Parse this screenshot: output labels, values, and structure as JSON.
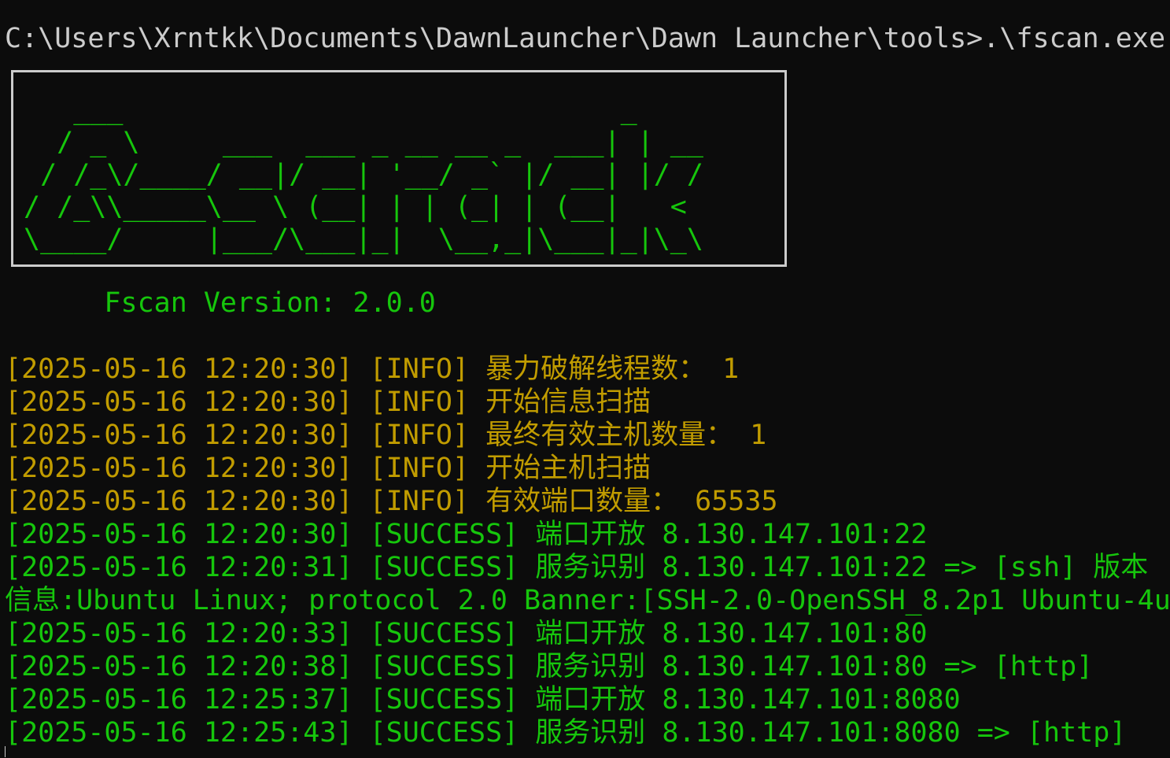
{
  "terminal": {
    "command_line": "C:\\Users\\Xrntkk\\Documents\\DawnLauncher\\Dawn Launcher\\tools>.\\fscan.exe",
    "banner_ascii": "   ___                              _\n  / _ \\     ___  ___ _ __ __ _  ___| | __\n / /_\\/____/ __|/ __| '__/ _` |/ __| |/ /\n/ /_\\\\_____\\__ \\ (__| | | (_| | (__|   <\n\\____/     |___/\\___|_|  \\__,_|\\___|_|\\_\\",
    "version_line": "      Fscan Version: 2.0.0",
    "colors": {
      "background": "#0c0c0c",
      "default_text": "#cccccc",
      "info": "#c19c00",
      "success": "#16c60c"
    },
    "log_lines": [
      {
        "level": "info",
        "text": "[2025-05-16 12:20:30] [INFO] 暴力破解线程数： 1"
      },
      {
        "level": "info",
        "text": "[2025-05-16 12:20:30] [INFO] 开始信息扫描"
      },
      {
        "level": "info",
        "text": "[2025-05-16 12:20:30] [INFO] 最终有效主机数量： 1"
      },
      {
        "level": "info",
        "text": "[2025-05-16 12:20:30] [INFO] 开始主机扫描"
      },
      {
        "level": "info",
        "text": "[2025-05-16 12:20:30] [INFO] 有效端口数量： 65535"
      },
      {
        "level": "success",
        "text": "[2025-05-16 12:20:30] [SUCCESS] 端口开放 8.130.147.101:22"
      },
      {
        "level": "success",
        "text": "[2025-05-16 12:20:31] [SUCCESS] 服务识别 8.130.147.101:22 => [ssh] 版本"
      },
      {
        "level": "success",
        "text": "信息:Ubuntu Linux; protocol 2.0 Banner:[SSH-2.0-OpenSSH_8.2p1 Ubuntu-4u"
      },
      {
        "level": "success",
        "text": "[2025-05-16 12:20:33] [SUCCESS] 端口开放 8.130.147.101:80"
      },
      {
        "level": "success",
        "text": "[2025-05-16 12:20:38] [SUCCESS] 服务识别 8.130.147.101:80 => [http]"
      },
      {
        "level": "success",
        "text": "[2025-05-16 12:25:37] [SUCCESS] 端口开放 8.130.147.101:8080"
      },
      {
        "level": "success",
        "text": "[2025-05-16 12:25:43] [SUCCESS] 服务识别 8.130.147.101:8080 => [http]"
      }
    ]
  }
}
